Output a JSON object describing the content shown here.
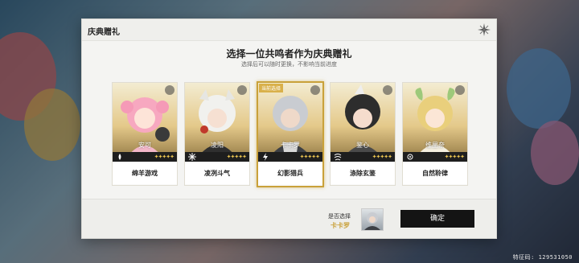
{
  "dialog": {
    "title": "庆典赠礼",
    "heading": "选择一位共鸣者作为庆典赠礼",
    "subheading": "选择后可以随时更换，不影响当前进度"
  },
  "characters": [
    {
      "name": "安可",
      "skin": "绵羊游戏",
      "stars": "✦✦✦✦✦",
      "element": "fusion-icon",
      "selected": false
    },
    {
      "name": "凌阳",
      "skin": "凌冽斗气",
      "stars": "✦✦✦✦✦",
      "element": "glacio-icon",
      "selected": false
    },
    {
      "name": "卡卡罗",
      "skin": "幻影猎兵",
      "stars": "✦✦✦✦✦",
      "element": "electro-icon",
      "selected": true,
      "badge": "当前选择"
    },
    {
      "name": "鉴心",
      "skin": "涤除玄鉴",
      "stars": "✦✦✦✦✦",
      "element": "aero-icon",
      "selected": false
    },
    {
      "name": "维里奈",
      "skin": "自然聆律",
      "stars": "✦✦✦✦✦",
      "element": "spectro-icon",
      "selected": false
    }
  ],
  "footer": {
    "question": "是否选择",
    "selected_name": "卡卡罗",
    "confirm_label": "确定"
  },
  "uid_text": "特征码: 129531050",
  "colors": {
    "accent_gold": "#c9a13a",
    "button_bg": "#141414"
  }
}
